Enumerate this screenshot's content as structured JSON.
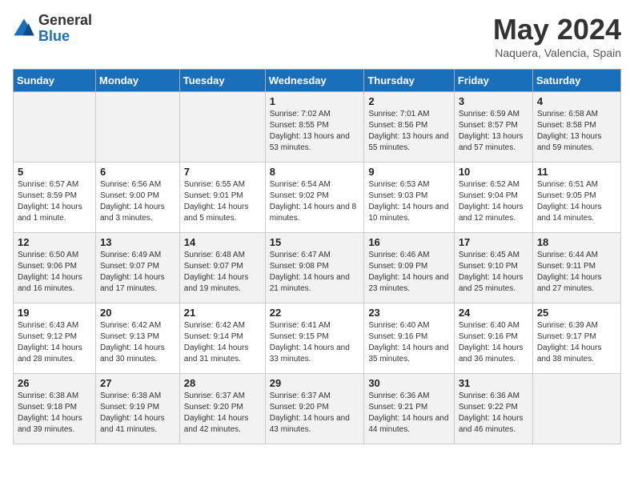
{
  "logo": {
    "general": "General",
    "blue": "Blue"
  },
  "title": "May 2024",
  "location": "Naquera, Valencia, Spain",
  "weekdays": [
    "Sunday",
    "Monday",
    "Tuesday",
    "Wednesday",
    "Thursday",
    "Friday",
    "Saturday"
  ],
  "weeks": [
    [
      {
        "day": "",
        "info": ""
      },
      {
        "day": "",
        "info": ""
      },
      {
        "day": "",
        "info": ""
      },
      {
        "day": "1",
        "info": "Sunrise: 7:02 AM\nSunset: 8:55 PM\nDaylight: 13 hours\nand 53 minutes."
      },
      {
        "day": "2",
        "info": "Sunrise: 7:01 AM\nSunset: 8:56 PM\nDaylight: 13 hours\nand 55 minutes."
      },
      {
        "day": "3",
        "info": "Sunrise: 6:59 AM\nSunset: 8:57 PM\nDaylight: 13 hours\nand 57 minutes."
      },
      {
        "day": "4",
        "info": "Sunrise: 6:58 AM\nSunset: 8:58 PM\nDaylight: 13 hours\nand 59 minutes."
      }
    ],
    [
      {
        "day": "5",
        "info": "Sunrise: 6:57 AM\nSunset: 8:59 PM\nDaylight: 14 hours\nand 1 minute."
      },
      {
        "day": "6",
        "info": "Sunrise: 6:56 AM\nSunset: 9:00 PM\nDaylight: 14 hours\nand 3 minutes."
      },
      {
        "day": "7",
        "info": "Sunrise: 6:55 AM\nSunset: 9:01 PM\nDaylight: 14 hours\nand 5 minutes."
      },
      {
        "day": "8",
        "info": "Sunrise: 6:54 AM\nSunset: 9:02 PM\nDaylight: 14 hours\nand 8 minutes."
      },
      {
        "day": "9",
        "info": "Sunrise: 6:53 AM\nSunset: 9:03 PM\nDaylight: 14 hours\nand 10 minutes."
      },
      {
        "day": "10",
        "info": "Sunrise: 6:52 AM\nSunset: 9:04 PM\nDaylight: 14 hours\nand 12 minutes."
      },
      {
        "day": "11",
        "info": "Sunrise: 6:51 AM\nSunset: 9:05 PM\nDaylight: 14 hours\nand 14 minutes."
      }
    ],
    [
      {
        "day": "12",
        "info": "Sunrise: 6:50 AM\nSunset: 9:06 PM\nDaylight: 14 hours\nand 16 minutes."
      },
      {
        "day": "13",
        "info": "Sunrise: 6:49 AM\nSunset: 9:07 PM\nDaylight: 14 hours\nand 17 minutes."
      },
      {
        "day": "14",
        "info": "Sunrise: 6:48 AM\nSunset: 9:07 PM\nDaylight: 14 hours\nand 19 minutes."
      },
      {
        "day": "15",
        "info": "Sunrise: 6:47 AM\nSunset: 9:08 PM\nDaylight: 14 hours\nand 21 minutes."
      },
      {
        "day": "16",
        "info": "Sunrise: 6:46 AM\nSunset: 9:09 PM\nDaylight: 14 hours\nand 23 minutes."
      },
      {
        "day": "17",
        "info": "Sunrise: 6:45 AM\nSunset: 9:10 PM\nDaylight: 14 hours\nand 25 minutes."
      },
      {
        "day": "18",
        "info": "Sunrise: 6:44 AM\nSunset: 9:11 PM\nDaylight: 14 hours\nand 27 minutes."
      }
    ],
    [
      {
        "day": "19",
        "info": "Sunrise: 6:43 AM\nSunset: 9:12 PM\nDaylight: 14 hours\nand 28 minutes."
      },
      {
        "day": "20",
        "info": "Sunrise: 6:42 AM\nSunset: 9:13 PM\nDaylight: 14 hours\nand 30 minutes."
      },
      {
        "day": "21",
        "info": "Sunrise: 6:42 AM\nSunset: 9:14 PM\nDaylight: 14 hours\nand 31 minutes."
      },
      {
        "day": "22",
        "info": "Sunrise: 6:41 AM\nSunset: 9:15 PM\nDaylight: 14 hours\nand 33 minutes."
      },
      {
        "day": "23",
        "info": "Sunrise: 6:40 AM\nSunset: 9:16 PM\nDaylight: 14 hours\nand 35 minutes."
      },
      {
        "day": "24",
        "info": "Sunrise: 6:40 AM\nSunset: 9:16 PM\nDaylight: 14 hours\nand 36 minutes."
      },
      {
        "day": "25",
        "info": "Sunrise: 6:39 AM\nSunset: 9:17 PM\nDaylight: 14 hours\nand 38 minutes."
      }
    ],
    [
      {
        "day": "26",
        "info": "Sunrise: 6:38 AM\nSunset: 9:18 PM\nDaylight: 14 hours\nand 39 minutes."
      },
      {
        "day": "27",
        "info": "Sunrise: 6:38 AM\nSunset: 9:19 PM\nDaylight: 14 hours\nand 41 minutes."
      },
      {
        "day": "28",
        "info": "Sunrise: 6:37 AM\nSunset: 9:20 PM\nDaylight: 14 hours\nand 42 minutes."
      },
      {
        "day": "29",
        "info": "Sunrise: 6:37 AM\nSunset: 9:20 PM\nDaylight: 14 hours\nand 43 minutes."
      },
      {
        "day": "30",
        "info": "Sunrise: 6:36 AM\nSunset: 9:21 PM\nDaylight: 14 hours\nand 44 minutes."
      },
      {
        "day": "31",
        "info": "Sunrise: 6:36 AM\nSunset: 9:22 PM\nDaylight: 14 hours\nand 46 minutes."
      },
      {
        "day": "",
        "info": ""
      }
    ]
  ]
}
